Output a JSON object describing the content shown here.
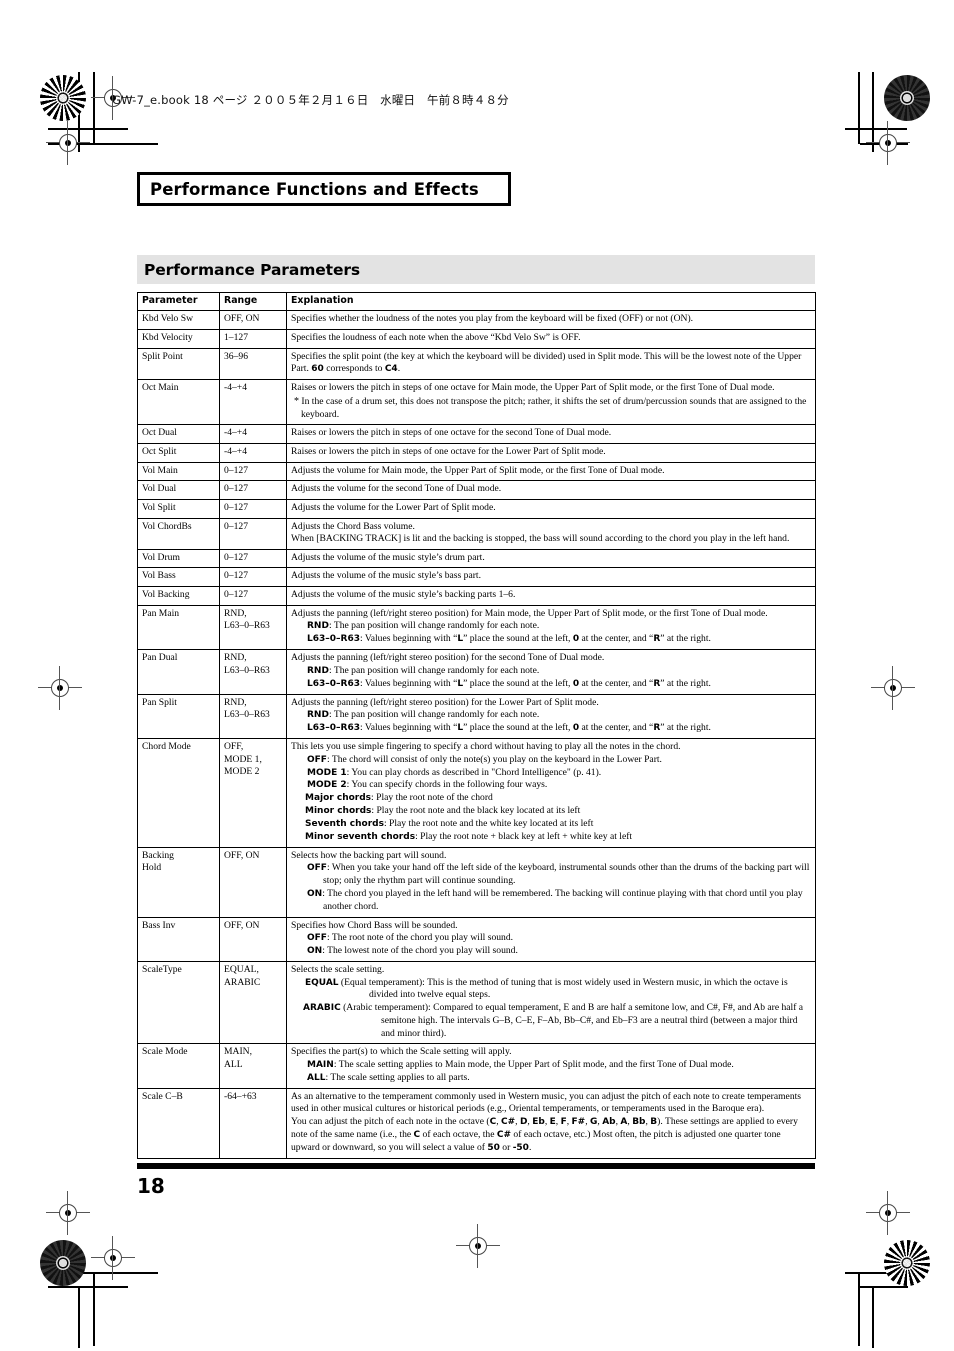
{
  "page": {
    "book_header": "GW-7_e.book 18 ページ ２００５年２月１６日　水曜日　午前８時４８分",
    "chapter_title": "Performance Functions and Effects",
    "section_title": "Performance Parameters",
    "page_number": "18"
  },
  "table": {
    "headers": [
      "Parameter",
      "Range",
      "Explanation"
    ],
    "rows": [
      {
        "param": "Kbd Velo Sw",
        "range": "OFF, ON",
        "lines": [
          {
            "indent": "base",
            "text": "Specifies whether the loudness of the notes you play from the keyboard will be fixed (OFF) or not (ON)."
          }
        ]
      },
      {
        "param": "Kbd Velocity",
        "range": "1–127",
        "lines": [
          {
            "indent": "base",
            "text": "Specifies the loudness of each note when the above “Kbd Velo Sw” is OFF."
          }
        ]
      },
      {
        "param": "Split Point",
        "range": "36–96",
        "lines": [
          {
            "indent": "base",
            "text": "Specifies the split point (the key at which the keyboard will be divided) used in Split mode. This will be the lowest note of the Upper Part. <b>60</b> corresponds to <b>C4</b>."
          }
        ]
      },
      {
        "param": "Oct Main",
        "range": "-4–+4",
        "lines": [
          {
            "indent": "base",
            "text": "Raises or lowers the pitch in steps of one octave for Main mode, the Upper Part of Split mode, or the first Tone of Dual mode."
          },
          {
            "indent": "note",
            "text": "<span class=\"sup\">*</span> In the case of a drum set, this does not transpose the pitch; rather, it shifts the set of drum/percussion sounds that are assigned to the keyboard."
          }
        ]
      },
      {
        "param": "Oct Dual",
        "range": "-4–+4",
        "lines": [
          {
            "indent": "base",
            "text": "Raises or lowers the pitch in steps of one octave for the second Tone of Dual mode."
          }
        ]
      },
      {
        "param": "Oct Split",
        "range": "-4–+4",
        "lines": [
          {
            "indent": "base",
            "text": "Raises or lowers the pitch in steps of one octave for the Lower Part of Split mode."
          }
        ]
      },
      {
        "param": "Vol Main",
        "range": "0–127",
        "lines": [
          {
            "indent": "base",
            "text": "Adjusts the volume for Main mode, the Upper Part of Split mode, or the first Tone of Dual mode."
          }
        ]
      },
      {
        "param": "Vol Dual",
        "range": "0–127",
        "lines": [
          {
            "indent": "base",
            "text": "Adjusts the volume for the second Tone of Dual mode."
          }
        ]
      },
      {
        "param": "Vol Split",
        "range": "0–127",
        "lines": [
          {
            "indent": "base",
            "text": "Adjusts the volume for the Lower Part of Split mode."
          }
        ]
      },
      {
        "param": "Vol ChordBs",
        "range": "0–127",
        "lines": [
          {
            "indent": "base",
            "text": "Adjusts the Chord Bass volume."
          },
          {
            "indent": "base",
            "text": "When [BACKING TRACK] is lit and the backing is stopped, the bass will sound according to the chord you play in the left hand."
          }
        ]
      },
      {
        "param": "Vol Drum",
        "range": "0–127",
        "lines": [
          {
            "indent": "base",
            "text": "Adjusts the volume of the music style’s drum part."
          }
        ]
      },
      {
        "param": "Vol Bass",
        "range": "0–127",
        "lines": [
          {
            "indent": "base",
            "text": "Adjusts the volume of the music style’s bass part."
          }
        ]
      },
      {
        "param": "Vol Backing",
        "range": "0–127",
        "lines": [
          {
            "indent": "base",
            "text": "Adjusts the volume of the music style’s backing parts 1–6."
          }
        ]
      },
      {
        "param": "Pan Main",
        "range": "RND,\nL63–0–R63",
        "lines": [
          {
            "indent": "base",
            "text": "Adjusts the panning (left/right stereo position) for Main mode, the Upper Part of Split mode, or the first Tone of Dual mode."
          },
          {
            "indent": "ind1",
            "text": "<b>RND</b>: The pan position will change randomly for each note."
          },
          {
            "indent": "ind1",
            "text": "<b>L63–0–R63</b>: Values beginning with “<b>L</b>” place the sound at the left, <b>0</b> at the center, and “<b>R</b>” at the right."
          }
        ]
      },
      {
        "param": "Pan Dual",
        "range": "RND,\nL63–0–R63",
        "lines": [
          {
            "indent": "base",
            "text": "Adjusts the panning (left/right stereo position) for the second Tone of Dual mode."
          },
          {
            "indent": "ind1",
            "text": "<b>RND</b>: The pan position will change randomly for each note."
          },
          {
            "indent": "ind1",
            "text": "<b>L63–0–R63</b>: Values beginning with “<b>L</b>” place the sound at the left, <b>0</b> at the center, and “<b>R</b>” at the right."
          }
        ]
      },
      {
        "param": "Pan Split",
        "range": "RND,\nL63–0–R63",
        "lines": [
          {
            "indent": "base",
            "text": "Adjusts the panning (left/right stereo position) for the Lower Part of Split mode."
          },
          {
            "indent": "ind1",
            "text": "<b>RND</b>: The pan position will change randomly for each note."
          },
          {
            "indent": "ind1",
            "text": "<b>L63–0–R63</b>: Values beginning with “<b>L</b>” place the sound at the left, <b>0</b> at the center, and “<b>R</b>” at the right."
          }
        ]
      },
      {
        "param": "Chord Mode",
        "range": "OFF,\nMODE 1,\nMODE 2",
        "lines": [
          {
            "indent": "base",
            "text": "This lets you use simple fingering to specify a chord without having to play all the notes in the chord."
          },
          {
            "indent": "ind1",
            "text": "<b>OFF</b>: The chord will consist of only the note(s) you play on the keyboard in the Lower Part."
          },
          {
            "indent": "ind1",
            "text": "<b>MODE 1</b>: You can play chords as described in \"Chord Intelligence\" (p. 41)."
          },
          {
            "indent": "ind1",
            "text": "<b>MODE 2</b>: You can specify chords in the following four ways."
          },
          {
            "indent": "ind2",
            "text": "<b>Major chords</b>: Play the root note of the chord"
          },
          {
            "indent": "ind2",
            "text": "<b>Minor chords</b>: Play the root note and the black key located at its left"
          },
          {
            "indent": "ind2",
            "text": "<b>Seventh chords</b>: Play the root note and the white key located at its left"
          },
          {
            "indent": "ind2",
            "text": "<b>Minor seventh chords</b>: Play the root note + black key at left + white key at left"
          }
        ]
      },
      {
        "param": "Backing\nHold",
        "range": "OFF, ON",
        "lines": [
          {
            "indent": "base",
            "text": "Selects how the backing part will sound."
          },
          {
            "indent": "ind1b",
            "text": "<b>OFF</b>: When you take your hand off the left side of the keyboard, instrumental sounds other than the drums of the backing part will stop; only the rhythm part will continue sounding."
          },
          {
            "indent": "ind1b",
            "text": "<b>ON</b>: The chord you played in the left hand will be remembered. The backing will continue playing with that chord until you play another chord."
          }
        ]
      },
      {
        "param": "Bass Inv",
        "range": "OFF, ON",
        "lines": [
          {
            "indent": "base",
            "text": "Specifies how Chord Bass will be sounded."
          },
          {
            "indent": "ind1",
            "text": "<b>OFF</b>: The root note of the chord you play will sound."
          },
          {
            "indent": "ind1",
            "text": "<b>ON</b>: The lowest note of the chord you play will sound."
          }
        ]
      },
      {
        "param": "ScaleType",
        "range": "EQUAL,\nARABIC",
        "lines": [
          {
            "indent": "base",
            "text": "Selects the scale setting."
          },
          {
            "indent": "ind2",
            "text": "<b>EQUAL</b> (Equal temperament): This is the method of tuning that is most widely used in Western music, in which the octave is divided into twelve equal steps."
          },
          {
            "indent": "ind3",
            "text": "<b>ARABIC</b> (Arabic temperament): Compared to equal temperament, E and B are half a semitone low, and C#, F#, and Ab are half a semitone high. The intervals G–B, C–E, F–Ab, Bb–C#, and Eb–F3 are a neutral third (between a major third and minor third)."
          }
        ]
      },
      {
        "param": "Scale Mode",
        "range": "MAIN,\nALL",
        "lines": [
          {
            "indent": "base",
            "text": "Specifies the part(s) to which the Scale setting will apply."
          },
          {
            "indent": "ind1",
            "text": "<b>MAIN</b>: The scale setting applies to Main mode, the Upper Part of Split mode, and the first Tone of Dual mode."
          },
          {
            "indent": "ind1",
            "text": "<b>ALL</b>: The scale setting applies to all parts."
          }
        ]
      },
      {
        "param": "Scale C–B",
        "range": "-64–+63",
        "lines": [
          {
            "indent": "base",
            "text": "As an alternative to the temperament commonly used in Western music, you can adjust the pitch of each note to create temperaments used in other musical cultures or historical periods (e.g., Oriental temperaments, or temperaments used in the Baroque era)."
          },
          {
            "indent": "base",
            "text": "You can adjust the pitch of each note in the octave (<b>C</b>, <b>C#</b>, <b>D</b>, <b>Eb</b>, <b>E</b>, <b>F</b>, <b>F#</b>, <b>G</b>, <b>Ab</b>, <b>A</b>, <b>Bb</b>, <b>B</b>). These settings are applied to every note of the same name (i.e., the <b>C</b> of each octave, the <b>C#</b> of each octave, etc.) Most often, the pitch is adjusted one quarter tone upward or downward, so you will select a value of <b>50</b> or <b>-50</b>."
          }
        ]
      }
    ]
  }
}
